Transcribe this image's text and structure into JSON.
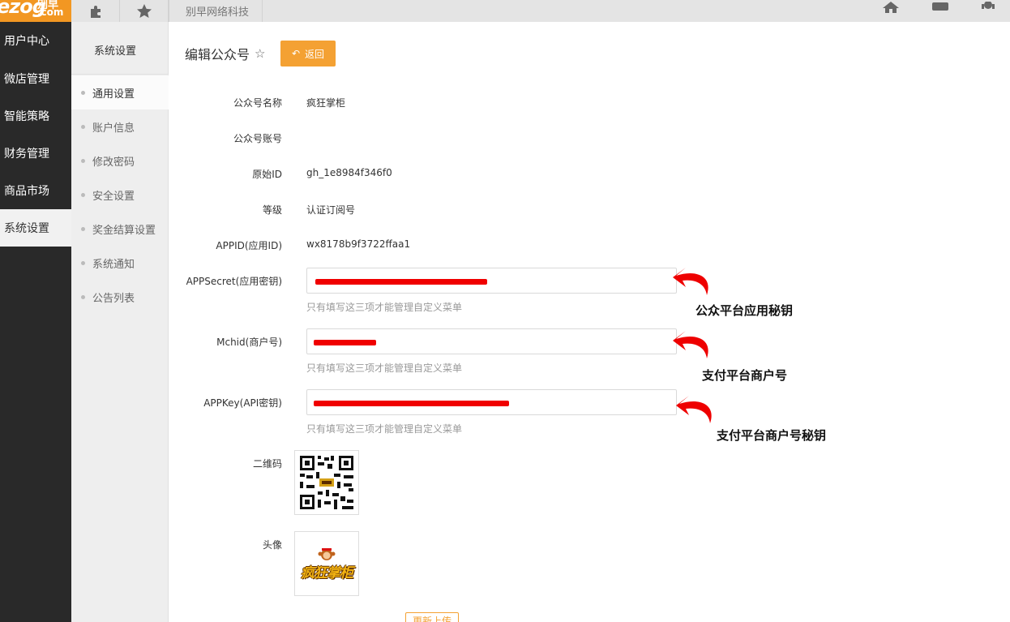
{
  "brand": {
    "logo_main": "ezog",
    "logo_cn": "别早",
    "logo_com": ".com"
  },
  "topbar": {
    "title": "别早网络科技"
  },
  "nav": {
    "items": [
      "用户中心",
      "微店管理",
      "智能策略",
      "财务管理",
      "商品市场",
      "系统设置"
    ],
    "active": "系统设置"
  },
  "subnav": {
    "title": "系统设置",
    "items": [
      "通用设置",
      "账户信息",
      "修改密码",
      "安全设置",
      "奖金结算设置",
      "系统通知",
      "公告列表"
    ],
    "active": "通用设置"
  },
  "page": {
    "title": "编辑公众号",
    "back_label": "返回"
  },
  "fields": {
    "name": {
      "label": "公众号名称",
      "value": "疯狂掌柜"
    },
    "account": {
      "label": "公众号账号",
      "value": ""
    },
    "original_id": {
      "label": "原始ID",
      "value": "gh_1e8984f346f0"
    },
    "level": {
      "label": "等级",
      "value": "认证订阅号"
    },
    "appid": {
      "label": "APPID(应用ID)",
      "value": "wx8178b9f3722ffaa1"
    },
    "appsecret": {
      "label": "APPSecret(应用密钥)",
      "help": "只有填写这三项才能管理自定义菜单"
    },
    "mchid": {
      "label": "Mchid(商户号)",
      "help": "只有填写这三项才能管理自定义菜单"
    },
    "appkey": {
      "label": "APPKey(API密钥)",
      "help": "只有填写这三项才能管理自定义菜单"
    },
    "qrcode": {
      "label": "二维码"
    },
    "avatar": {
      "label": "头像",
      "image_text": "疯狂掌柜"
    },
    "upload_label": "更新上传"
  },
  "annotations": {
    "appsecret": "公众平台应用秘钥",
    "mchid": "支付平台商户号",
    "appkey": "支付平台商户号秘钥"
  },
  "colors": {
    "accent": "#f4a133",
    "nav_bg": "#292929",
    "redact": "#f00000",
    "arrow": "#ee0000"
  },
  "icons": [
    "puzzle-icon",
    "star-icon",
    "home-icon",
    "message-icon",
    "support-icon",
    "reply-arrow-icon",
    "star-outline-icon"
  ]
}
